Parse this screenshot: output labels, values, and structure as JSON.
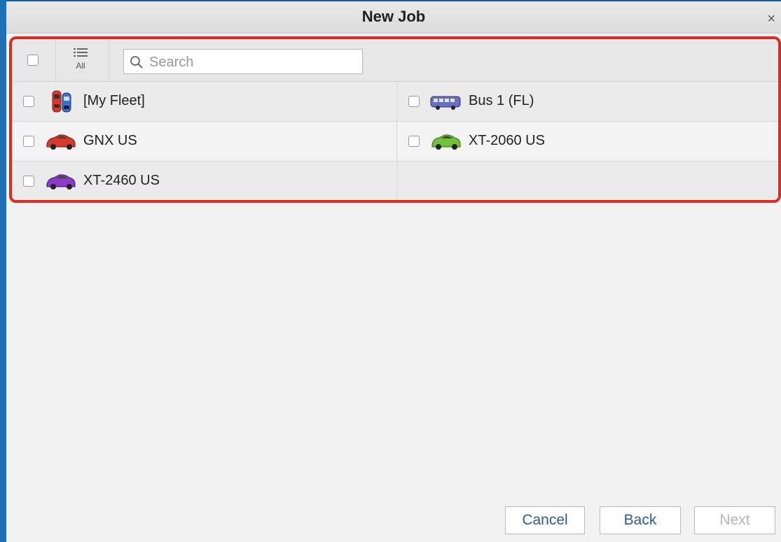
{
  "dialog": {
    "title": "New Job",
    "close_glyph": "×"
  },
  "toolbar": {
    "list_all_label": "All",
    "search_placeholder": "Search",
    "search_value": ""
  },
  "vehicles": [
    {
      "label": "[My Fleet]",
      "icon": "fleet-cars-icon",
      "checked": false
    },
    {
      "label": "Bus 1 (FL)",
      "icon": "bus-icon",
      "checked": false
    },
    {
      "label": "GNX US",
      "icon": "red-car-icon",
      "color": "#d83a2a",
      "checked": false
    },
    {
      "label": "XT-2060 US",
      "icon": "green-car-icon",
      "color": "#6fc23a",
      "checked": false
    },
    {
      "label": "XT-2460 US",
      "icon": "purple-car-icon",
      "color": "#8a3cc8",
      "checked": false
    }
  ],
  "footer": {
    "cancel_label": "Cancel",
    "back_label": "Back",
    "next_label": "Next"
  },
  "colors": {
    "highlight_border": "#e02a1c",
    "button_text": "#2c5aa0",
    "desktop": "#1f6fb5"
  }
}
